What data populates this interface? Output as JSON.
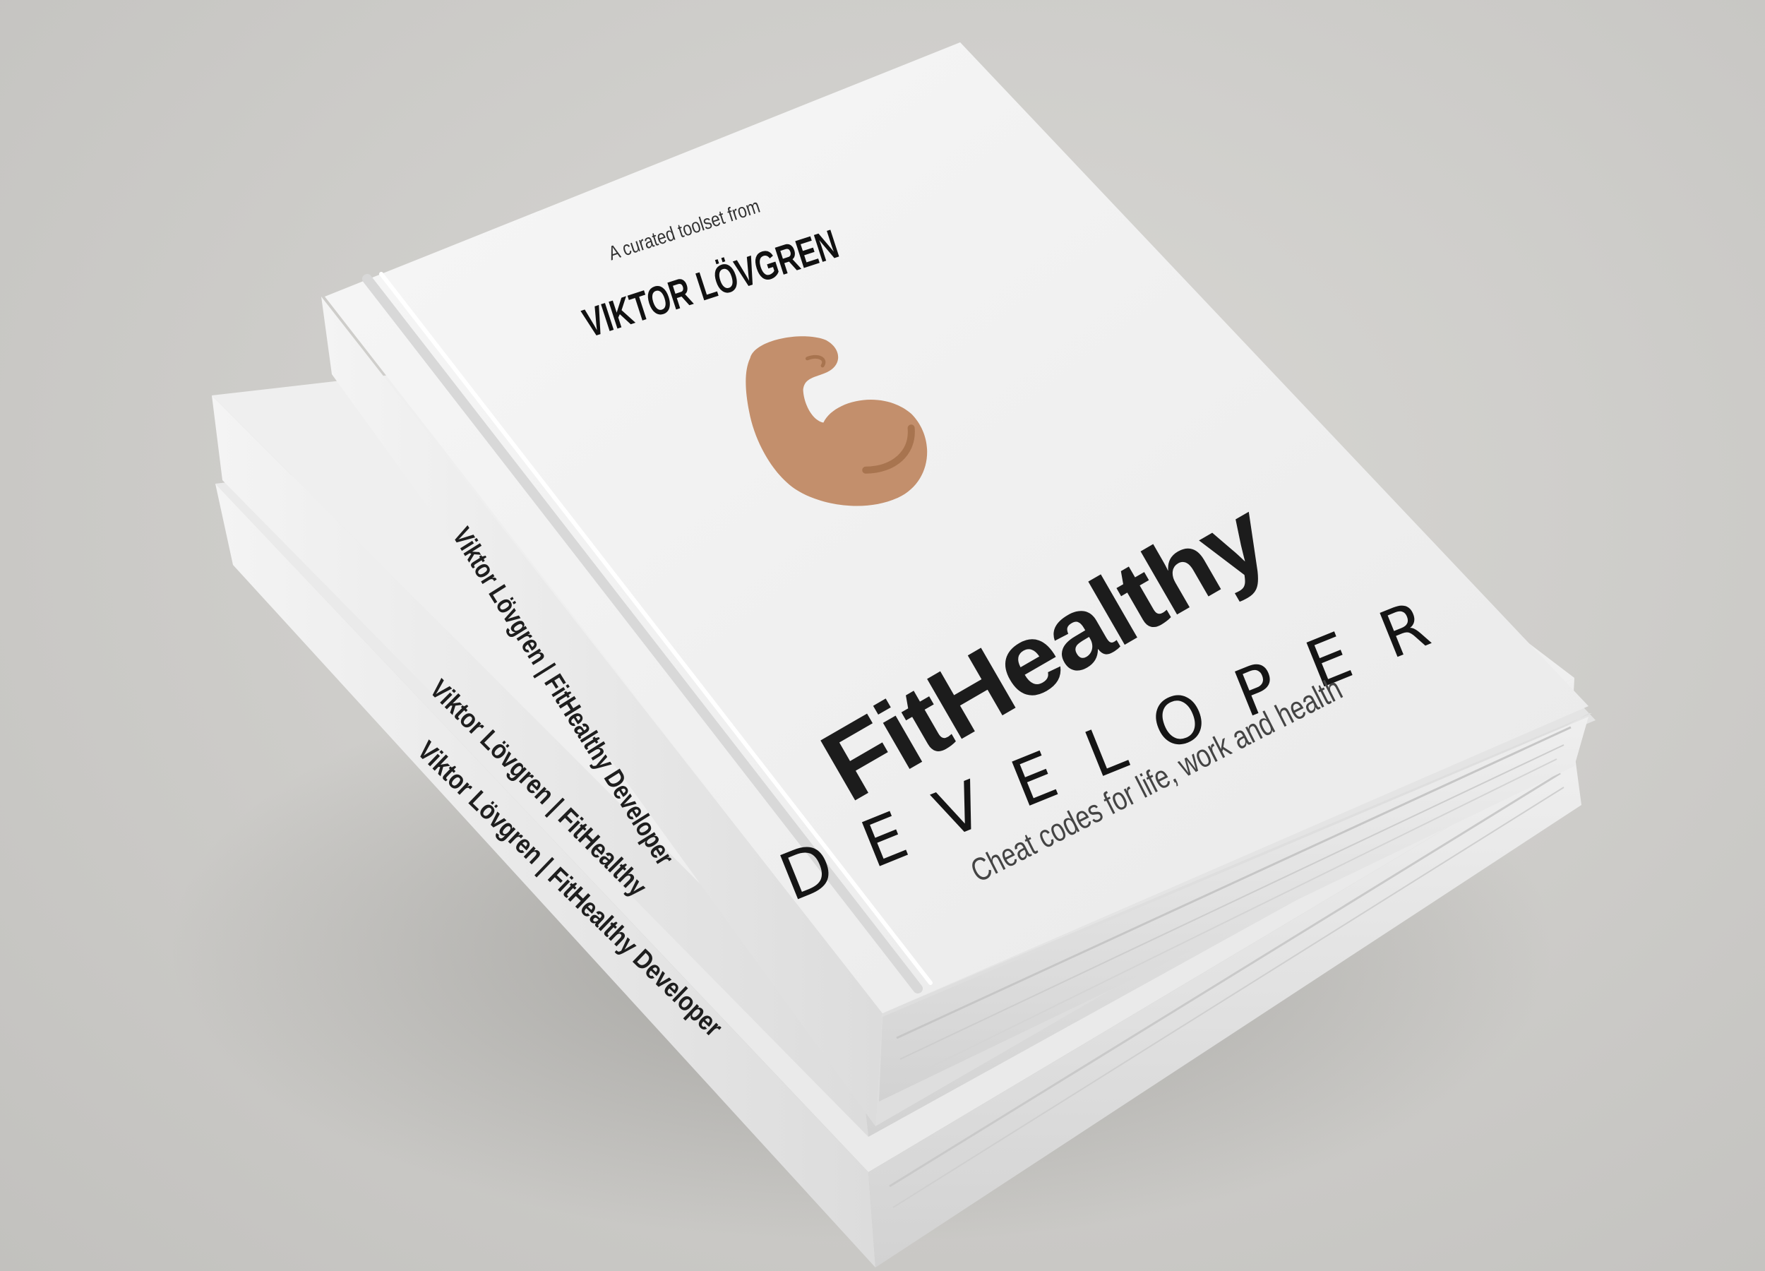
{
  "cover": {
    "tagline": "A curated toolset from",
    "author": "VIKTOR LÖVGREN",
    "title": "FitHealthy",
    "subtitle": "DEVELOPER",
    "slogan": "Cheat codes for life, work and health",
    "icon": "flexed-biceps-icon"
  },
  "spines": [
    {
      "label": "Viktor Lövgren | FitHealthy Developer"
    },
    {
      "label": "Viktor Lövgren | FitHealthy"
    },
    {
      "label": "Viktor Lövgren | FitHealthy Developer"
    }
  ],
  "colors": {
    "background": "#cfcecb",
    "cover": "#f2f2f2",
    "arm": "#c38f6c",
    "arm_detail": "#a8744f",
    "text": "#1c1c1c"
  }
}
